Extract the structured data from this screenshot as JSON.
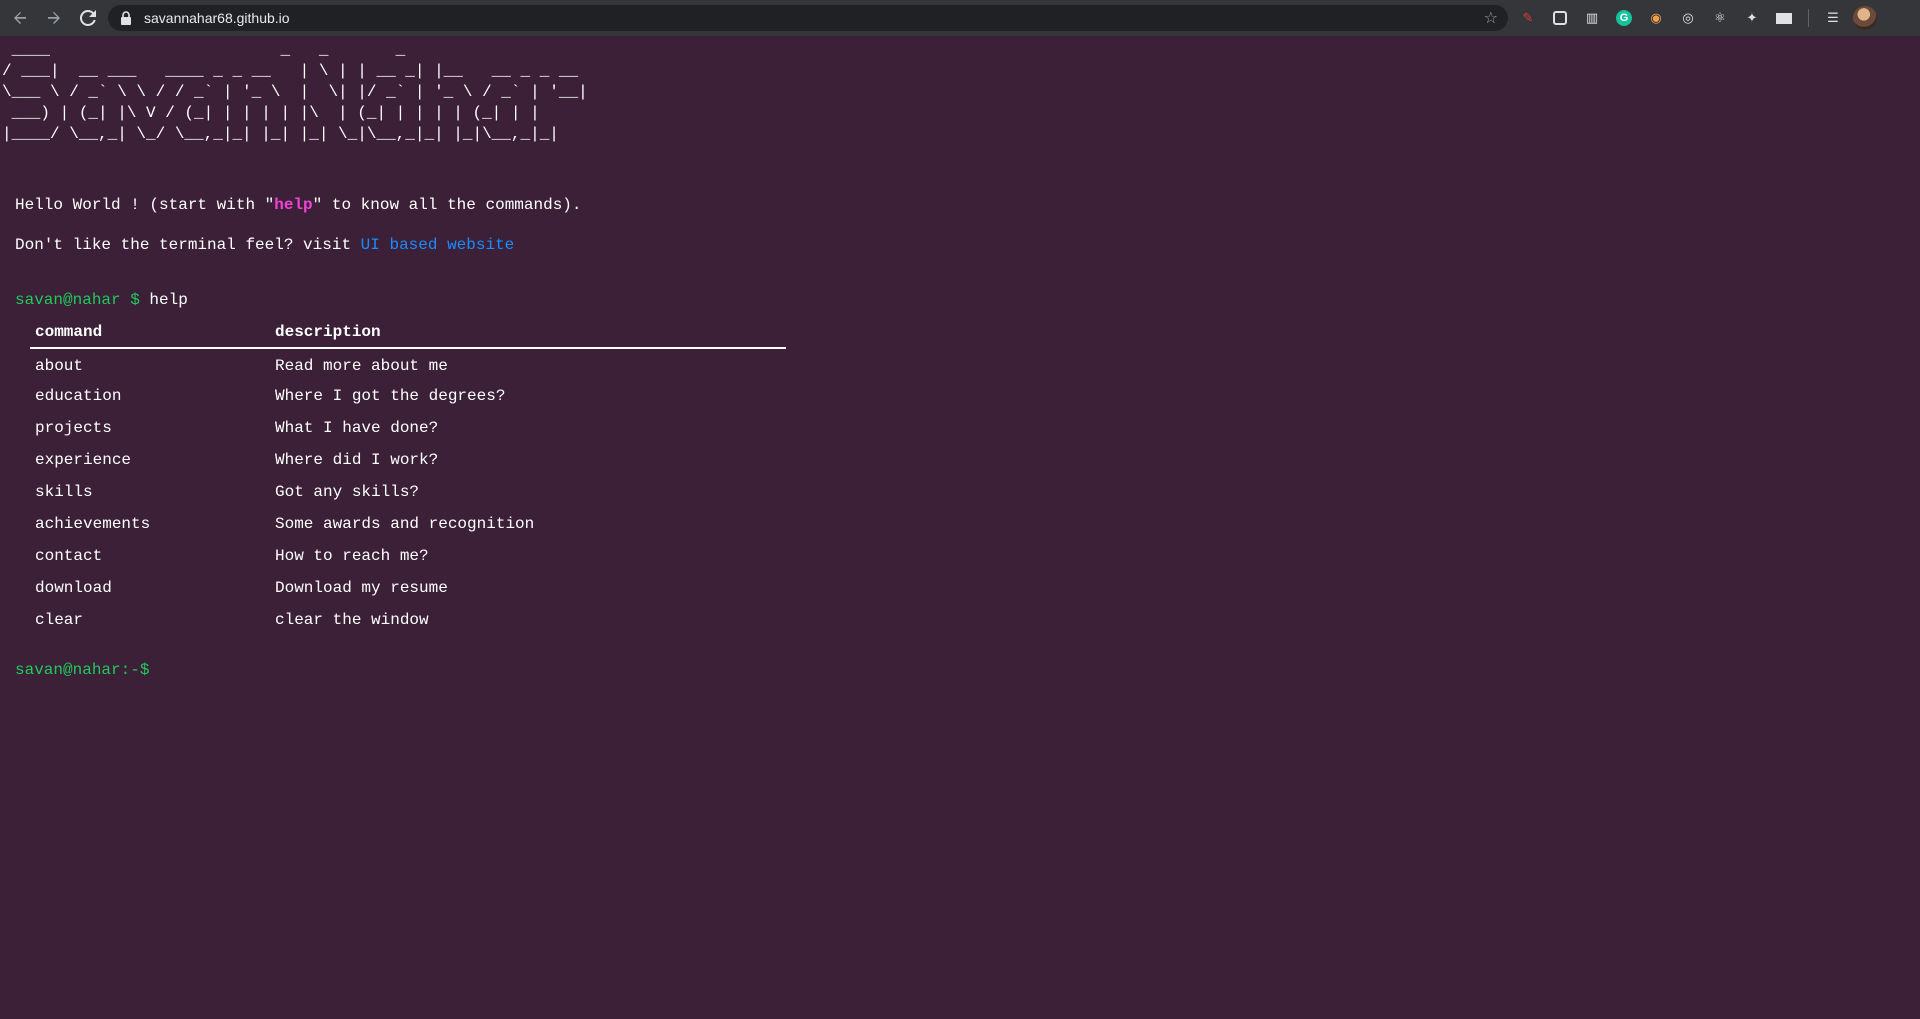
{
  "browser": {
    "url": "savannahar68.github.io"
  },
  "icons": {
    "back": "arrow-left-icon",
    "forward": "arrow-right-icon",
    "reload": "reload-icon",
    "lock": "lock-icon",
    "bookmark": "star-icon"
  },
  "terminal": {
    "ascii_banner": " ____                        _   _       _\n/ ___|  __ ___   ____ _ _ __   | \\ | | __ _| |__   __ _ _ __\n\\___ \\ / _` \\ \\ / / _` | '_ \\  |  \\| |/ _` | '_ \\ / _` | '__|\n ___) | (_| |\\ V / (_| | | | | |\\  | (_| | | | | (_| | |\n|____/ \\__,_| \\_/ \\__,_|_| |_| |_| \\_|\\__,_|_| |_|\\__,_|_|",
    "welcome_before": "Hello World ! (start with \"",
    "welcome_keyword": "help",
    "welcome_after": "\" to know all the commands).",
    "alt_text": "Don't like the terminal feel? visit ",
    "alt_link": "UI based website",
    "prompt_user": "savan@nahar $ ",
    "entered_command": "help",
    "table": {
      "headers": [
        "command",
        "description"
      ],
      "rows": [
        [
          "about",
          "Read more about me"
        ],
        [
          "education",
          "Where I got the degrees?"
        ],
        [
          "projects",
          "What I have done?"
        ],
        [
          "experience",
          "Where did I work?"
        ],
        [
          "skills",
          "Got any skills?"
        ],
        [
          "achievements",
          "Some awards and recognition"
        ],
        [
          "contact",
          "How to reach me?"
        ],
        [
          "download",
          "Download my resume"
        ],
        [
          "clear",
          "clear the window"
        ]
      ]
    },
    "final_prompt": "savan@nahar:-$"
  },
  "colors": {
    "background": "#3b2037",
    "prompt": "#20c95c",
    "keyword": "#ef43d8",
    "link": "#1a8cff"
  }
}
